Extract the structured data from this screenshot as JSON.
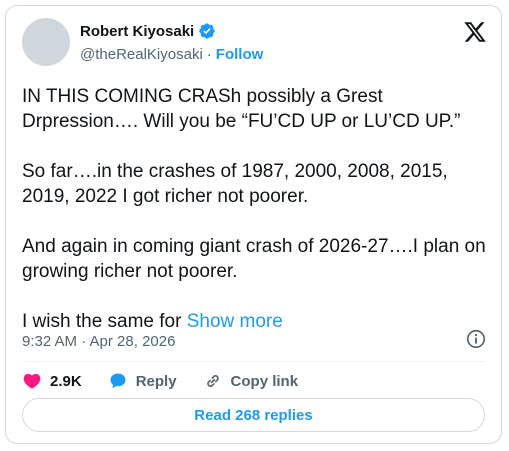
{
  "author": {
    "name": "Robert Kiyosaki",
    "handle": "@theRealKiyosaki",
    "separator": "·",
    "follow_label": "Follow"
  },
  "tweet": {
    "paragraphs": [
      "IN THIS COMING CRASh possibly a Grest Drpression…. Will you be “FU’CD UP or LU’CD UP.”",
      "So far….in the crashes of 1987, 2000, 2008, 2015, 2019, 2022 I got richer not poorer.",
      "And again in coming giant crash of 2026-27….I plan on growing richer not poorer."
    ],
    "last_paragraph": "I wish the same for",
    "show_more": "Show more",
    "timestamp": "9:32 AM · Apr 28, 2026"
  },
  "actions": {
    "likes": "2.9K",
    "reply_label": "Reply",
    "copy_link_label": "Copy link"
  },
  "replies_button": "Read 268 replies",
  "colors": {
    "accent": "#1d9bf0",
    "like": "#f91880",
    "muted": "#536471"
  }
}
